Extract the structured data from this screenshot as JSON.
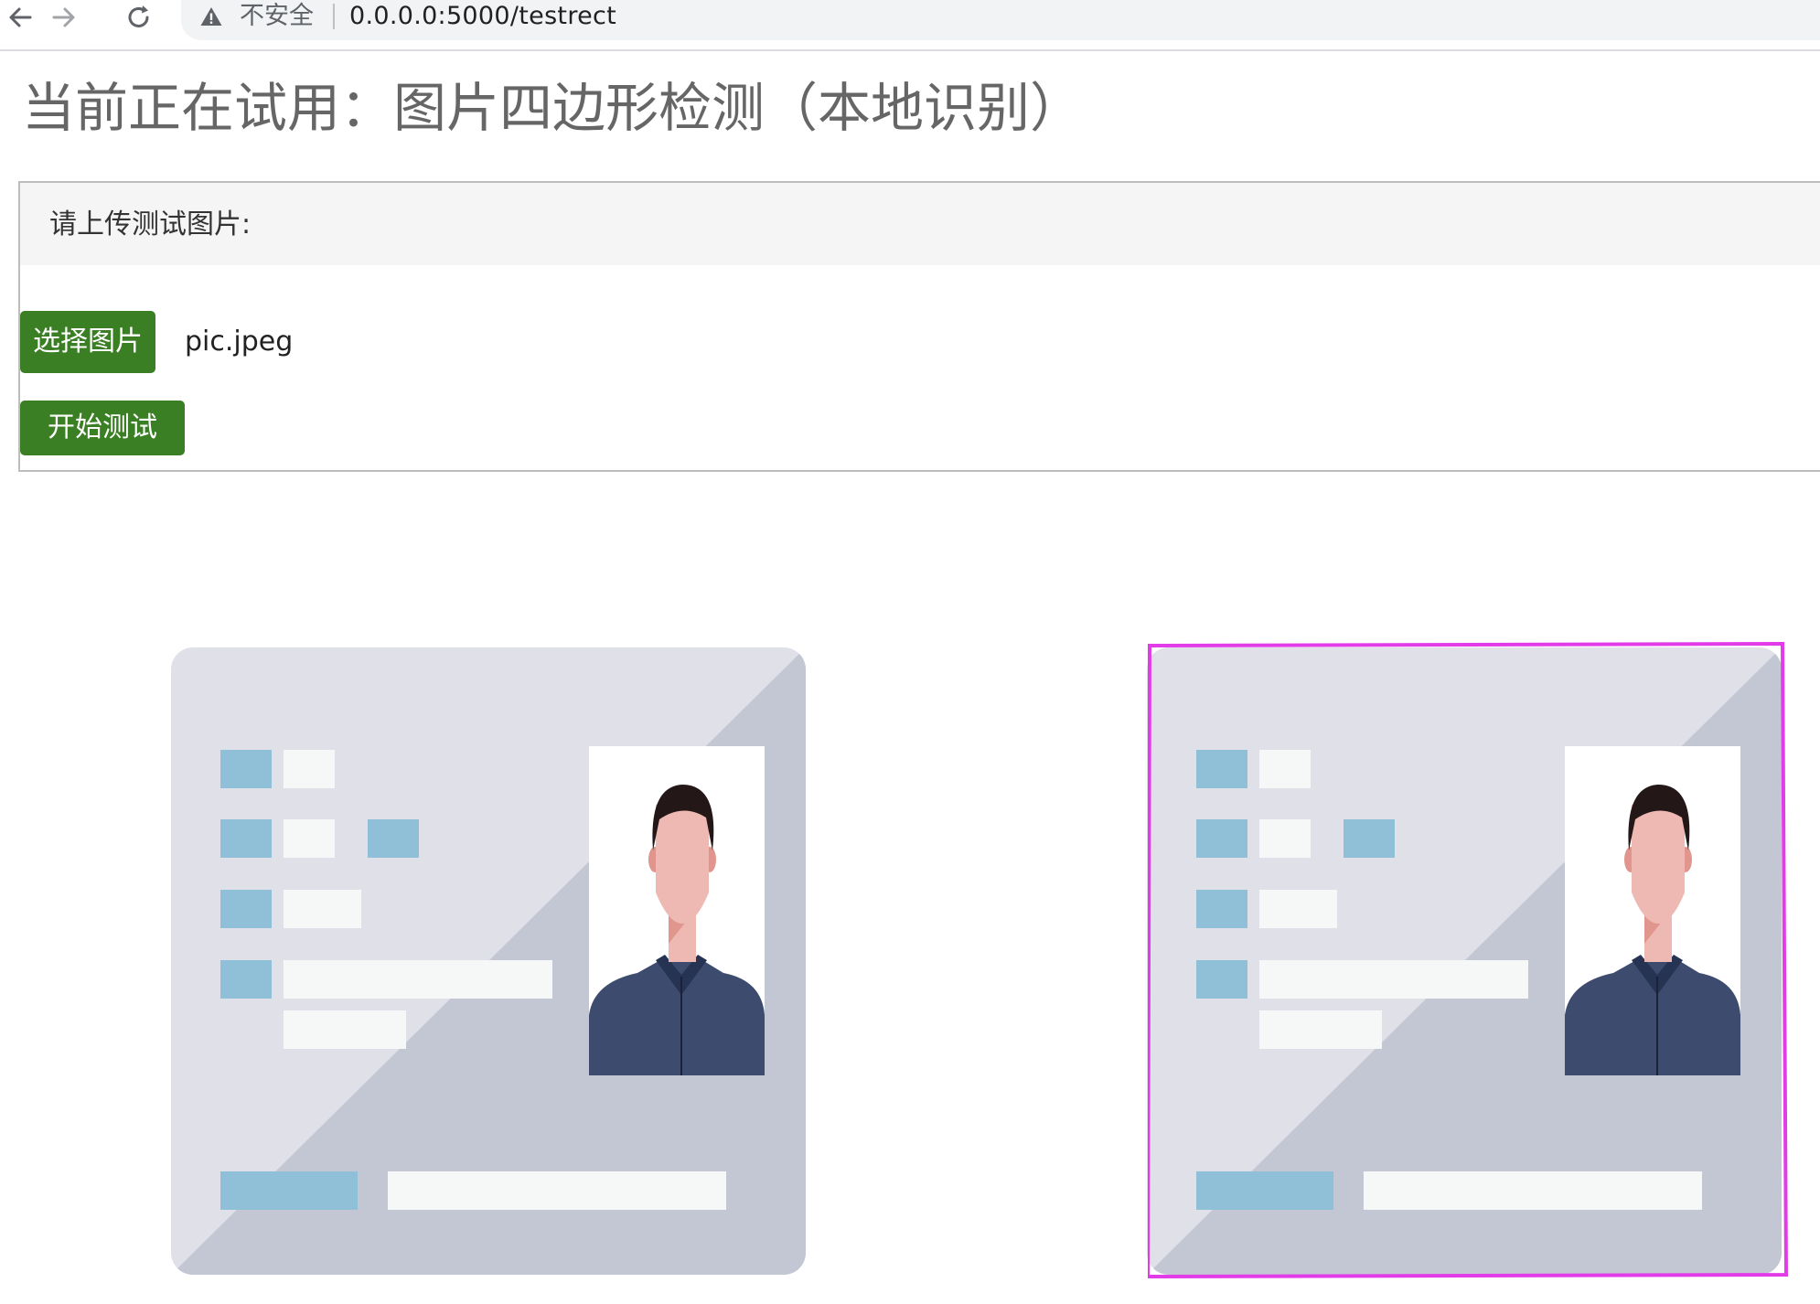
{
  "browser": {
    "security_label": "不安全",
    "url": "0.0.0.0:5000/testrect",
    "icons": [
      "back-arrow-icon",
      "forward-arrow-icon",
      "reload-icon",
      "warning-icon"
    ]
  },
  "page": {
    "title": "当前正在试用：图片四边形检测（本地识别）"
  },
  "upload_panel": {
    "heading": "请上传测试图片:",
    "select_button_label": "选择图片",
    "file_name": "pic.jpeg",
    "start_button_label": "开始测试"
  },
  "colors": {
    "button_green": "#3a7f23",
    "detection_outline": "#e23ce8",
    "card_background": "#dfe0e8",
    "card_shade": "#c3c6d3",
    "field_blue": "#8fc0d8",
    "field_white": "#f6f7f7",
    "jacket_navy": "#3d4b6e"
  },
  "images": {
    "original": {
      "name": "original-id-card-image"
    },
    "detected": {
      "name": "detected-id-card-image",
      "outline_name": "detected-quadrilateral"
    }
  }
}
